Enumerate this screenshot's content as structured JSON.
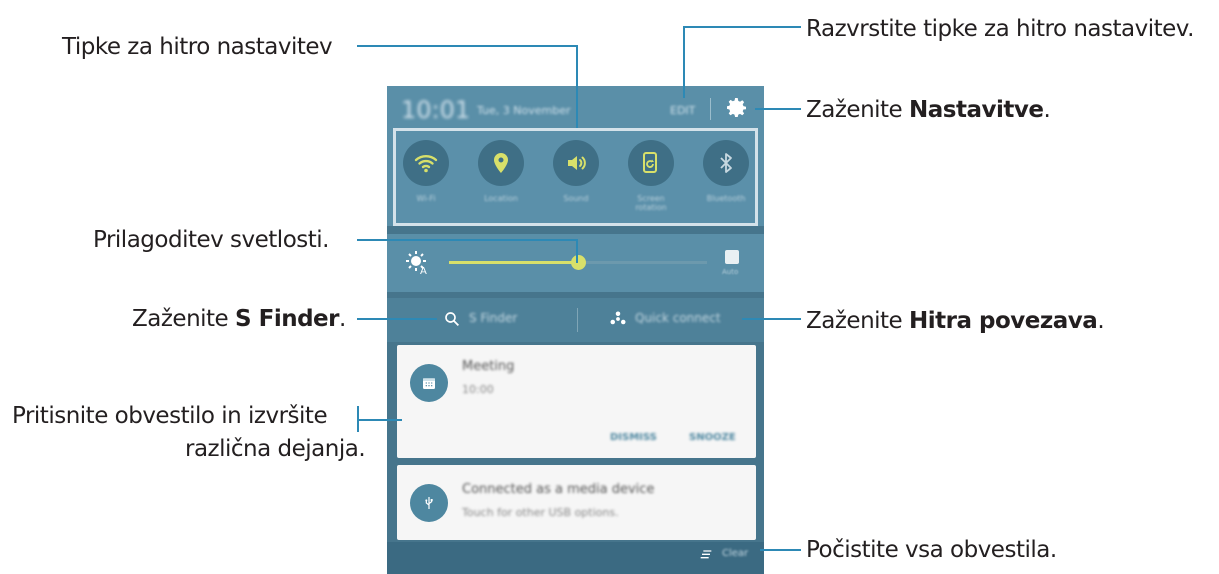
{
  "labels": {
    "quick_buttons": "Tipke za hitro nastavitev",
    "brightness": "Prilagoditev svetlosti.",
    "sfinder_prefix": "Zaženite ",
    "sfinder_bold": "S Finder",
    "sfinder_suffix": ".",
    "notification_line1": "Pritisnite obvestilo in izvršite",
    "notification_line2": "različna dejanja.",
    "rearrange": "Razvrstite tipke za hitro nastavitev.",
    "settings_prefix": "Zaženite ",
    "settings_bold": "Nastavitve",
    "settings_suffix": ".",
    "quickconnect_prefix": "Zaženite ",
    "quickconnect_bold": "Hitra povezava",
    "quickconnect_suffix": ".",
    "clear_all": "Počistite vsa obvestila."
  },
  "phone": {
    "time": "10:01",
    "date": "Tue, 3 November",
    "edit": "EDIT",
    "quick_settings": [
      {
        "icon": "wifi-icon",
        "label": "Wi-Fi"
      },
      {
        "icon": "location-icon",
        "label": "Location"
      },
      {
        "icon": "sound-icon",
        "label": "Sound"
      },
      {
        "icon": "screen-rotation-icon",
        "label": "Screen rotation"
      },
      {
        "icon": "bluetooth-icon",
        "label": "Bluetooth"
      }
    ],
    "brightness_level": 0.5,
    "auto_label": "Auto",
    "s_finder": "S Finder",
    "quick_connect": "Quick connect",
    "notifications": [
      {
        "icon": "calendar-icon",
        "title": "Meeting",
        "subtitle": "10:00",
        "actions": [
          "DISMISS",
          "SNOOZE"
        ]
      },
      {
        "icon": "usb-icon",
        "title": "Connected as a media device",
        "subtitle": "Touch for other USB options."
      }
    ],
    "clear": "Clear"
  },
  "colors": {
    "callout_line": "#2d89b5",
    "panel": "#5a8fa8",
    "accent": "#d8e06a"
  }
}
